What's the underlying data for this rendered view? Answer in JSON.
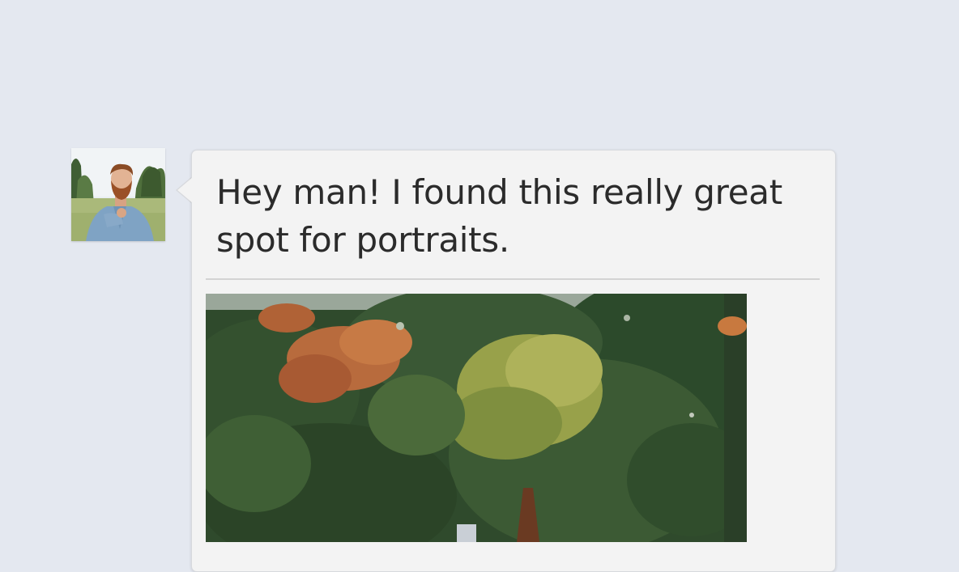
{
  "message": {
    "text": "Hey man! I found this really great spot for portraits.",
    "sender_avatar_icon": "bearded-man-avatar",
    "attachment": {
      "kind": "photo",
      "subject": "trees-with-autumn-foliage"
    }
  },
  "colors": {
    "background": "#e4e8f0",
    "bubble": "#f3f3f3",
    "bubble_border": "#d7d9dd",
    "text": "#2b2b2b",
    "divider": "#d3d3d3"
  }
}
